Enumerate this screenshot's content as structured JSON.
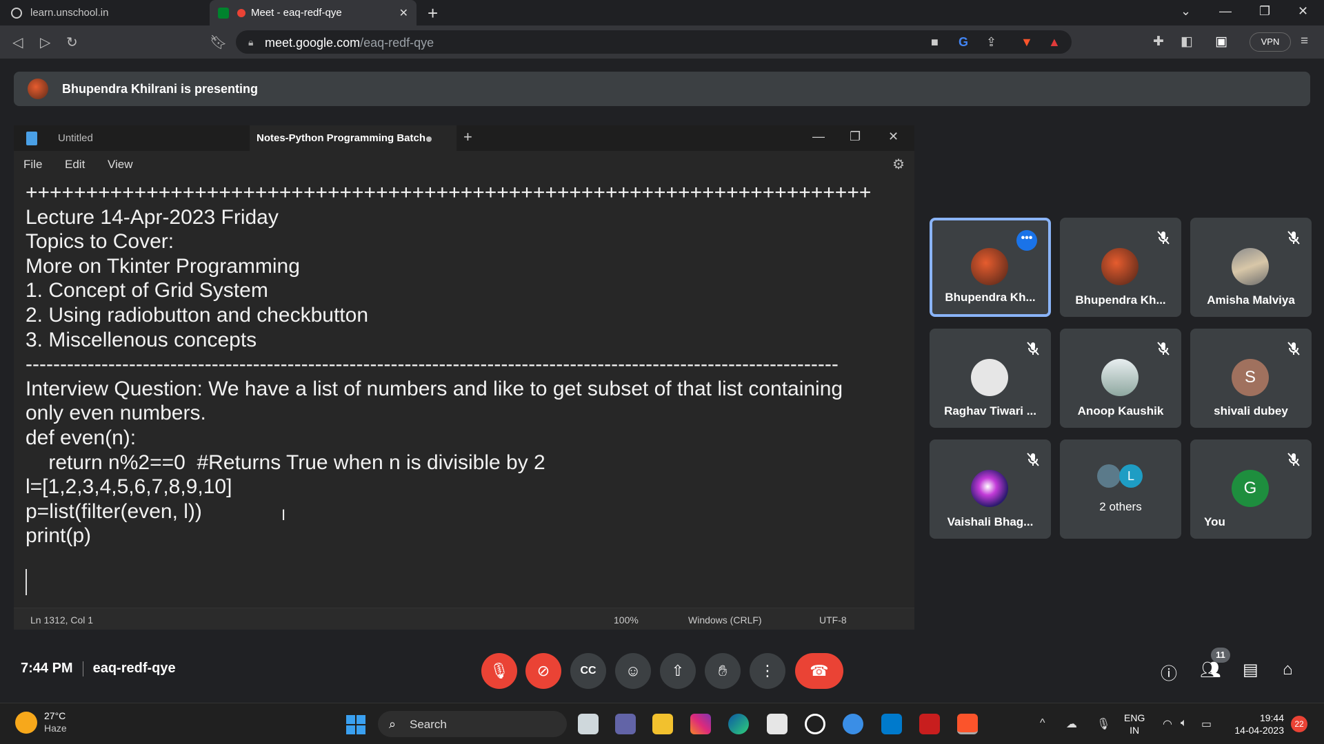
{
  "browser": {
    "tabs": [
      {
        "title": "learn.unschool.in",
        "active": false
      },
      {
        "title": "Meet - eaq-redf-qye",
        "active": true
      }
    ],
    "url_domain": "meet.google.com",
    "url_path": "/eaq-redf-qye",
    "vpn_label": "VPN"
  },
  "meet": {
    "presenting_banner": "Bhupendra Khilrani is presenting",
    "time": "7:44 PM",
    "meeting_code": "eaq-redf-qye",
    "participant_count": "11",
    "participants": [
      {
        "name": "Bhupendra Kh...",
        "avatar": "logo",
        "muted": false,
        "speaking": true
      },
      {
        "name": "Bhupendra Kh...",
        "avatar": "logo",
        "muted": true
      },
      {
        "name": "Amisha Malviya",
        "avatar": "photo",
        "muted": true
      },
      {
        "name": "Raghav Tiwari ...",
        "avatar": "cartoon",
        "muted": true
      },
      {
        "name": "Anoop Kaushik",
        "avatar": "photo",
        "muted": true
      },
      {
        "name": "shivali dubey",
        "avatar": "S",
        "avatar_color": "#a0715e",
        "muted": true
      },
      {
        "name": "Vaishali Bhag...",
        "avatar": "galaxy",
        "muted": true
      },
      {
        "name": "2 others",
        "avatar": "L",
        "avatar_color": "#1e9dc4",
        "muted": false
      },
      {
        "name": "You",
        "avatar": "G",
        "avatar_color": "#1e8e3e",
        "muted": true
      }
    ]
  },
  "notepad": {
    "tab_untitled": "Untitled",
    "tab_active": "Notes-Python Programming Batch",
    "menu": [
      "File",
      "Edit",
      "View"
    ],
    "lines": [
      "++++++++++++++++++++++++++++++++++++++++++++++++++++++++++++++++++++++",
      "Lecture 14-Apr-2023 Friday",
      "Topics to Cover:",
      "More on Tkinter Programming",
      "1. Concept of Grid System",
      "2. Using radiobutton and checkbutton",
      "3. Miscellenous concepts",
      "----------------------------------------------------------------------------------------------------------------------",
      "Interview Question: We have a list of numbers and like to get subset of that list containing",
      "only even numbers.",
      "def even(n):",
      "    return n%2==0  #Returns True when n is divisible by 2",
      "l=[1,2,3,4,5,6,7,8,9,10]",
      "p=list(filter(even, l))",
      "print(p)"
    ],
    "status": {
      "position": "Ln 1312, Col 1",
      "zoom": "100%",
      "line_ending": "Windows (CRLF)",
      "encoding": "UTF-8"
    }
  },
  "taskbar": {
    "temperature": "27°C",
    "condition": "Haze",
    "search_label": "Search",
    "lang_top": "ENG",
    "lang_bottom": "IN",
    "clock_time": "19:44",
    "clock_date": "14-04-2023",
    "notification_count": "22"
  },
  "colors": {
    "accent_blue": "#8ab4f8",
    "meet_red": "#ea4335",
    "tile_bg": "#3c4043"
  }
}
